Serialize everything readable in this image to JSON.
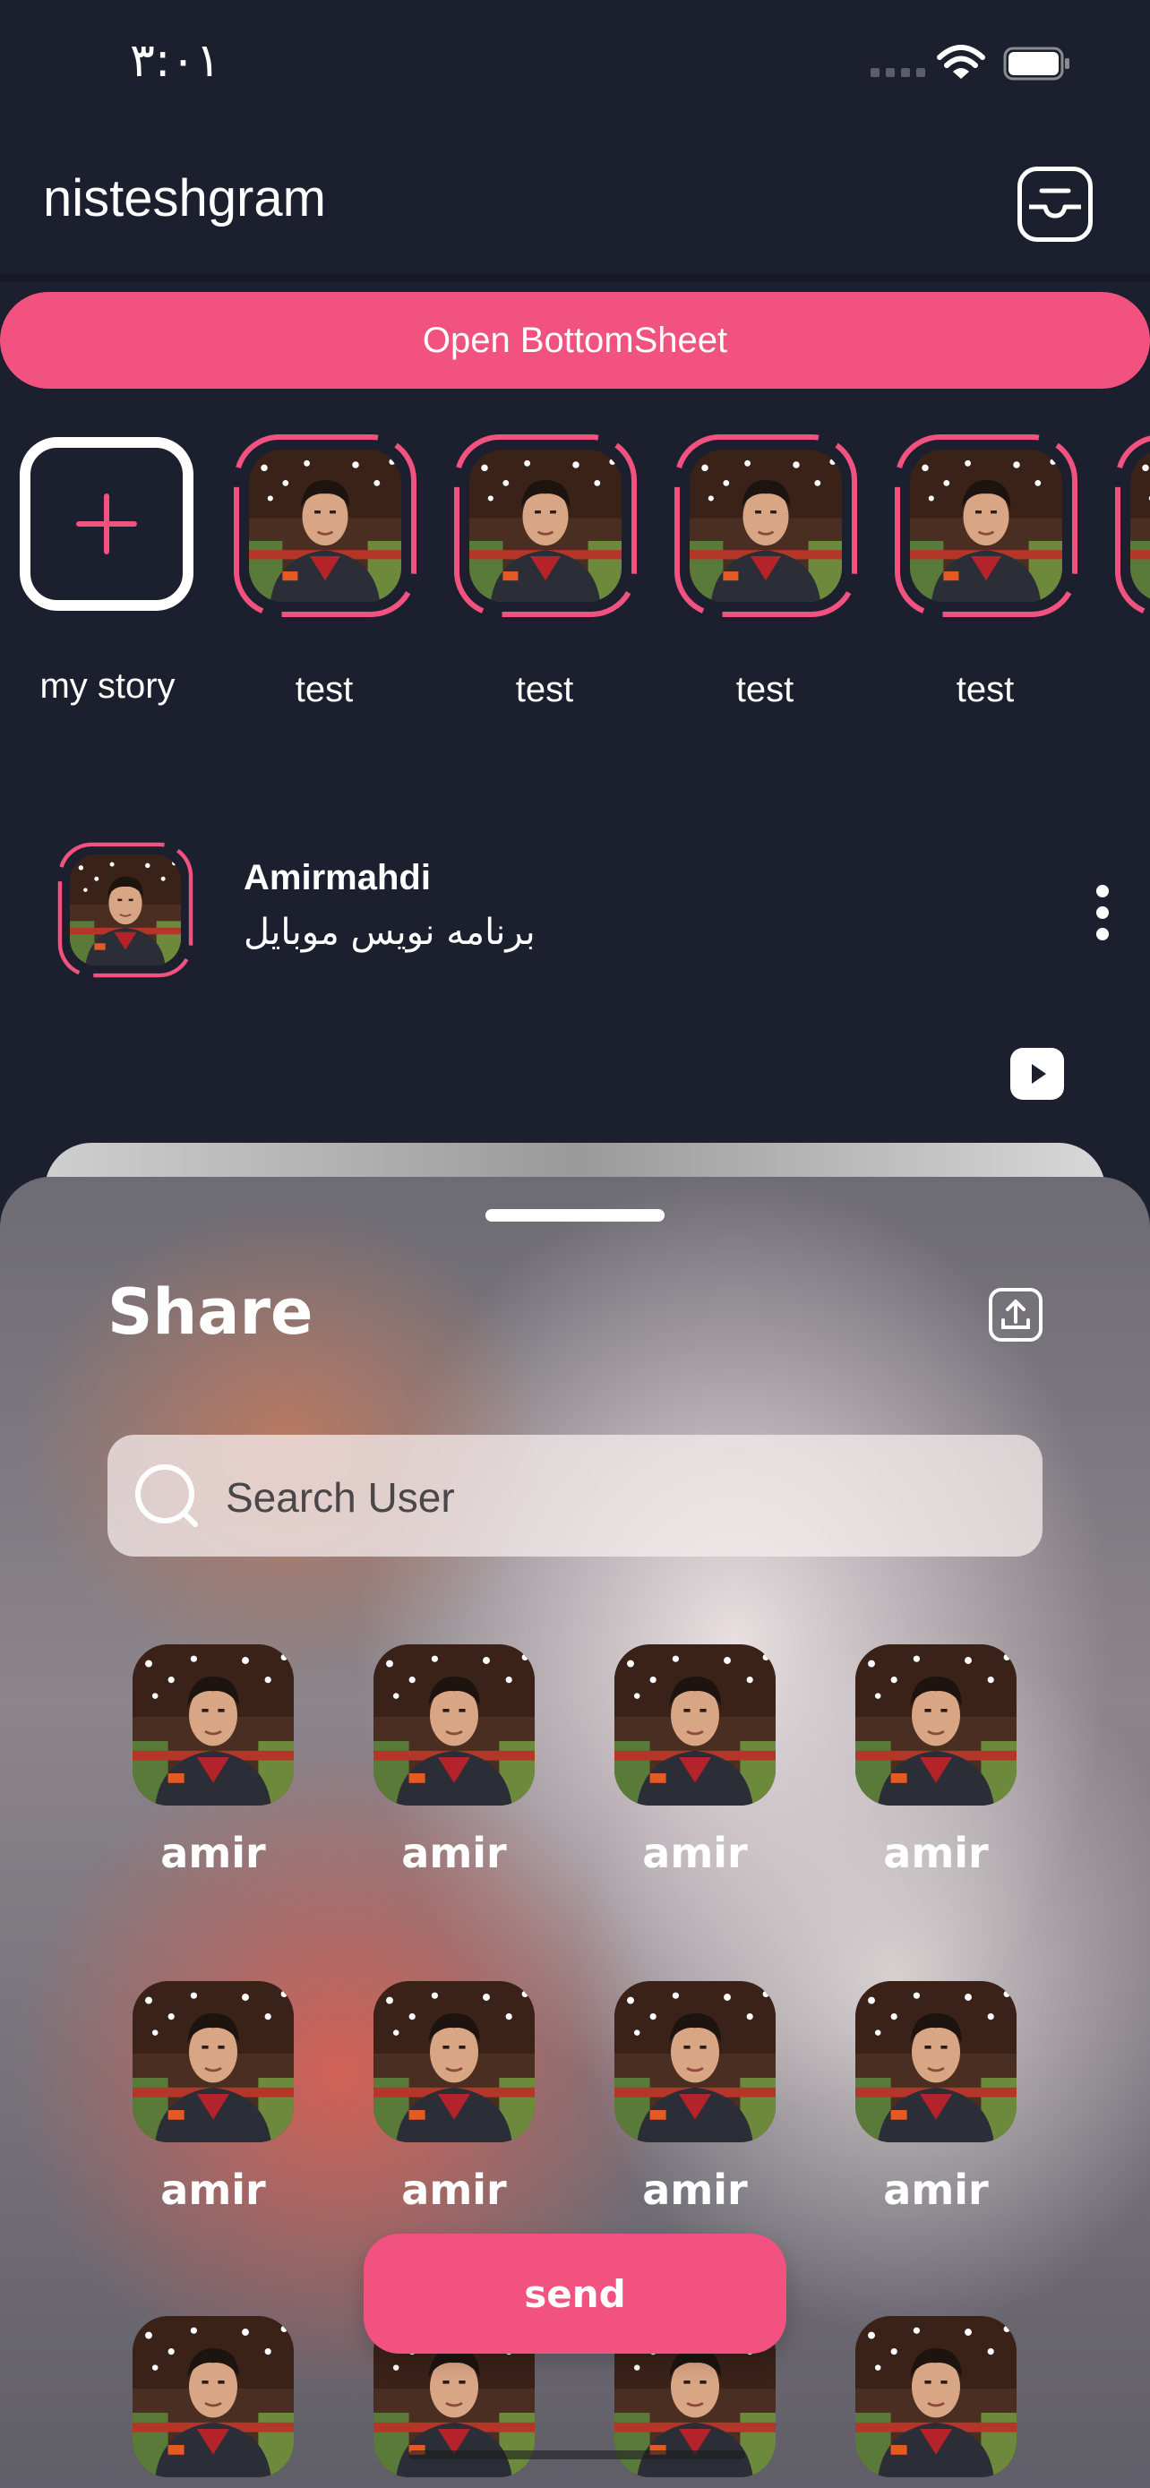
{
  "status_bar": {
    "time": "۳:۰۱"
  },
  "header": {
    "title": "nisteshgram",
    "inbox_icon": "inbox-tray-icon"
  },
  "open_button": {
    "label": "Open BottomSheet"
  },
  "stories": {
    "my_story_label": "my story",
    "items": [
      {
        "label": "test"
      },
      {
        "label": "test"
      },
      {
        "label": "test"
      },
      {
        "label": "test"
      }
    ]
  },
  "post": {
    "author": "Amirmahdi",
    "subtitle": "برنامه نویس موبایل",
    "more_icon": "more-vertical-icon",
    "media_icon": "play-icon"
  },
  "share_sheet": {
    "title": "Share",
    "upload_icon": "upload-icon",
    "search_placeholder": "Search User",
    "users": [
      {
        "name": "amir"
      },
      {
        "name": "amir"
      },
      {
        "name": "amir"
      },
      {
        "name": "amir"
      },
      {
        "name": "amir"
      },
      {
        "name": "amir"
      },
      {
        "name": "amir"
      },
      {
        "name": "amir"
      },
      {
        "name": ""
      },
      {
        "name": ""
      },
      {
        "name": ""
      },
      {
        "name": ""
      }
    ],
    "send_label": "send"
  },
  "colors": {
    "background": "#1c1f2e",
    "accent": "#f2527f"
  }
}
